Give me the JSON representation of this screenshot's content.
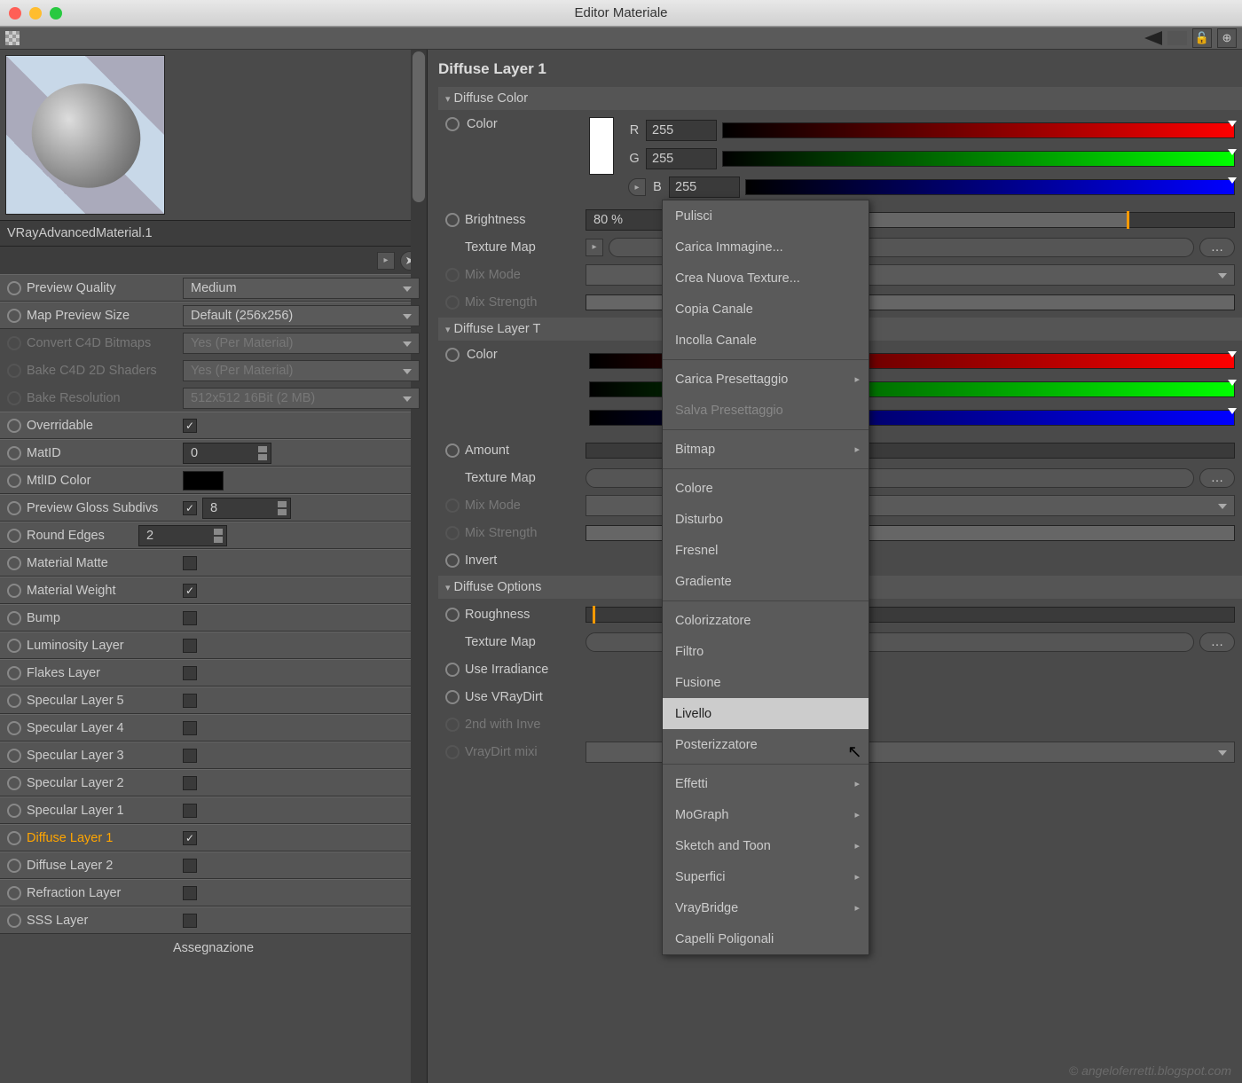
{
  "window": {
    "title": "Editor Materiale"
  },
  "left": {
    "material_name": "VRayAdvancedMaterial.1",
    "preview_quality": {
      "label": "Preview Quality",
      "value": "Medium"
    },
    "map_preview_size": {
      "label": "Map Preview Size",
      "value": "Default (256x256)"
    },
    "convert_bitmaps": {
      "label": "Convert C4D Bitmaps",
      "value": "Yes (Per Material)"
    },
    "bake_shaders": {
      "label": "Bake C4D 2D Shaders",
      "value": "Yes (Per Material)"
    },
    "bake_resolution": {
      "label": "Bake Resolution",
      "value": "512x512   16Bit   (2 MB)"
    },
    "overridable": {
      "label": "Overridable",
      "checked": true
    },
    "matid": {
      "label": "MatID",
      "value": "0"
    },
    "mtlid_color": {
      "label": "MtlID Color"
    },
    "preview_gloss": {
      "label": "Preview Gloss Subdivs",
      "checked": true,
      "value": "8"
    },
    "round_edges": {
      "label": "Round Edges",
      "value": "2"
    },
    "channels": [
      {
        "label": "Material Matte",
        "checked": false
      },
      {
        "label": "Material Weight",
        "checked": true
      },
      {
        "label": "Bump",
        "checked": false
      },
      {
        "label": "Luminosity Layer",
        "checked": false
      },
      {
        "label": "Flakes Layer",
        "checked": false
      },
      {
        "label": "Specular Layer 5",
        "checked": false
      },
      {
        "label": "Specular Layer 4",
        "checked": false
      },
      {
        "label": "Specular Layer 3",
        "checked": false
      },
      {
        "label": "Specular Layer 2",
        "checked": false
      },
      {
        "label": "Specular Layer 1",
        "checked": false
      },
      {
        "label": "Diffuse Layer 1",
        "checked": true,
        "active": true
      },
      {
        "label": "Diffuse Layer 2",
        "checked": false
      },
      {
        "label": "Refraction Layer",
        "checked": false
      },
      {
        "label": "SSS Layer",
        "checked": false
      }
    ],
    "assignment": "Assegnazione"
  },
  "right": {
    "title": "Diffuse Layer 1",
    "diffuse_color": {
      "head": "Diffuse Color",
      "color_label": "Color",
      "r": "255",
      "g": "255",
      "b": "255",
      "brightness_label": "Brightness",
      "brightness_value": "80 %",
      "texture_label": "Texture Map",
      "mix_mode_label": "Mix Mode",
      "mix_strength_label": "Mix Strength"
    },
    "layer_trans": {
      "head": "Diffuse Layer T",
      "color_label": "Color",
      "amount_label": "Amount",
      "texture_label": "Texture Map",
      "mix_mode_label": "Mix Mode",
      "mix_strength_label": "Mix Strength",
      "invert_label": "Invert"
    },
    "options": {
      "head": "Diffuse Options",
      "roughness_label": "Roughness",
      "texture_label": "Texture Map",
      "irradiance_label": "Use Irradiance",
      "vraydirt_label": "Use VRayDirt",
      "second_label": "2nd with Inve",
      "mixing_label": "VrayDirt mixi"
    }
  },
  "menu": {
    "items": [
      {
        "label": "Pulisci"
      },
      {
        "label": "Carica Immagine..."
      },
      {
        "label": "Crea Nuova Texture..."
      },
      {
        "label": "Copia Canale"
      },
      {
        "label": "Incolla Canale"
      },
      {
        "sep": true
      },
      {
        "label": "Carica Presettaggio",
        "sub": true
      },
      {
        "label": "Salva Presettaggio",
        "disabled": true
      },
      {
        "sep": true
      },
      {
        "label": "Bitmap",
        "sub": true
      },
      {
        "sep": true
      },
      {
        "label": "Colore"
      },
      {
        "label": "Disturbo"
      },
      {
        "label": "Fresnel"
      },
      {
        "label": "Gradiente"
      },
      {
        "sep": true
      },
      {
        "label": "Colorizzatore"
      },
      {
        "label": "Filtro"
      },
      {
        "label": "Fusione"
      },
      {
        "label": "Livello",
        "hover": true
      },
      {
        "label": "Posterizzatore"
      },
      {
        "sep": true
      },
      {
        "label": "Effetti",
        "sub": true
      },
      {
        "label": "MoGraph",
        "sub": true
      },
      {
        "label": "Sketch and Toon",
        "sub": true
      },
      {
        "label": "Superfici",
        "sub": true
      },
      {
        "label": "VrayBridge",
        "sub": true
      },
      {
        "label": "Capelli Poligonali"
      }
    ]
  },
  "watermark": "© angeloferretti.blogspot.com"
}
